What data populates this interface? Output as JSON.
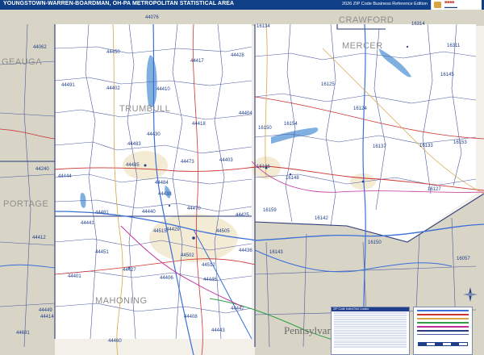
{
  "title": "YOUNGSTOWN-WARREN-BOARDMAN, OH-PA METROPOLITAN STATISTICAL AREA",
  "edition": "2026 ZIP Code Business Reference Edition",
  "legend": {
    "zip_header": "ZIP Code Index/Grid Locator"
  },
  "colors": {
    "title_bg": "#0e3f87",
    "zip_text": "#1f3e8c",
    "outside": "#d8d4c6",
    "boundary": "#2a3a7a",
    "interstate": "#3a6fd8",
    "us_route": "#cc3333"
  },
  "counties": [
    {
      "name": "GEAUGA"
    },
    {
      "name": "TRUMBULL"
    },
    {
      "name": "PORTAGE"
    },
    {
      "name": "MAHONING"
    },
    {
      "name": "CRAWFORD"
    },
    {
      "name": "MERCER"
    }
  ],
  "state_label": "Pennsylvan",
  "zip_labels": [
    "44076",
    "44062",
    "44450",
    "44417",
    "44428",
    "44491",
    "44402",
    "44410",
    "44418",
    "44404",
    "44430",
    "44473",
    "44403",
    "44444",
    "44240",
    "44481",
    "44483",
    "44485",
    "44484",
    "44438",
    "44440",
    "44425",
    "44505",
    "44515",
    "44512",
    "44451",
    "44502",
    "44436",
    "44401",
    "44406",
    "44442",
    "44443",
    "44408",
    "44460",
    "44681",
    "44449",
    "44414",
    "16134",
    "16314",
    "16311",
    "16125",
    "16145",
    "16124",
    "16154",
    "16150",
    "16133",
    "16137",
    "16153",
    "16146",
    "16148",
    "16159",
    "16127",
    "16142",
    "16150",
    "16143",
    "16057",
    "44412",
    "44429",
    "44427",
    "44441",
    "44470",
    "44446"
  ]
}
